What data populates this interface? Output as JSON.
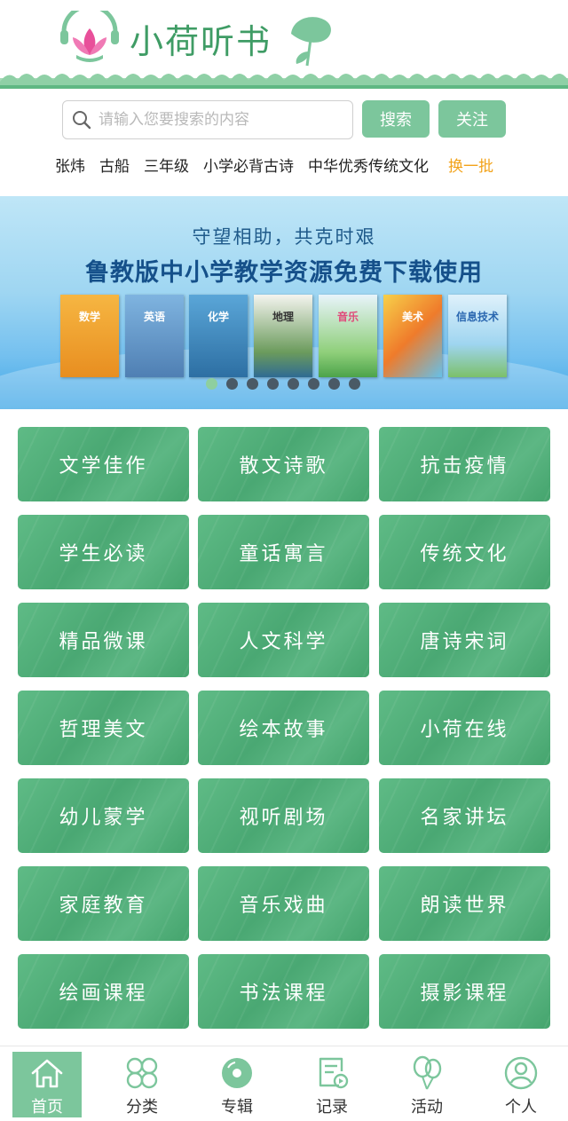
{
  "header": {
    "app_name": "小荷听书"
  },
  "search": {
    "placeholder": "请输入您要搜索的内容",
    "value": "",
    "search_label": "搜索",
    "follow_label": "关注"
  },
  "hot_keywords": [
    "张炜",
    "古船",
    "三年级",
    "小学必背古诗",
    "中华优秀传统文化"
  ],
  "refresh_label": "换一批",
  "banner": {
    "subtitle": "守望相助，共克时艰",
    "title": "鲁教版中小学教学资源免费下载使用",
    "books": [
      "数学",
      "英语",
      "化学",
      "地理",
      "音乐",
      "美术",
      "信息技术"
    ],
    "slide_count": 8,
    "active_slide": 1
  },
  "categories": [
    "文学佳作",
    "散文诗歌",
    "抗击疫情",
    "学生必读",
    "童话寓言",
    "传统文化",
    "精品微课",
    "人文科学",
    "唐诗宋词",
    "哲理美文",
    "绘本故事",
    "小荷在线",
    "幼儿蒙学",
    "视听剧场",
    "名家讲坛",
    "家庭教育",
    "音乐戏曲",
    "朗读世界",
    "绘画课程",
    "书法课程",
    "摄影课程"
  ],
  "nav": {
    "items": [
      {
        "label": "首页",
        "icon": "home-icon",
        "active": true
      },
      {
        "label": "分类",
        "icon": "category-icon",
        "active": false
      },
      {
        "label": "专辑",
        "icon": "album-icon",
        "active": false
      },
      {
        "label": "记录",
        "icon": "record-icon",
        "active": false
      },
      {
        "label": "活动",
        "icon": "activity-icon",
        "active": false
      },
      {
        "label": "个人",
        "icon": "profile-icon",
        "active": false
      }
    ]
  },
  "colors": {
    "brand_green": "#3f9c65",
    "button_green": "#7cc69c",
    "refresh_orange": "#f2a31b",
    "tile_green": "#4aa873"
  }
}
